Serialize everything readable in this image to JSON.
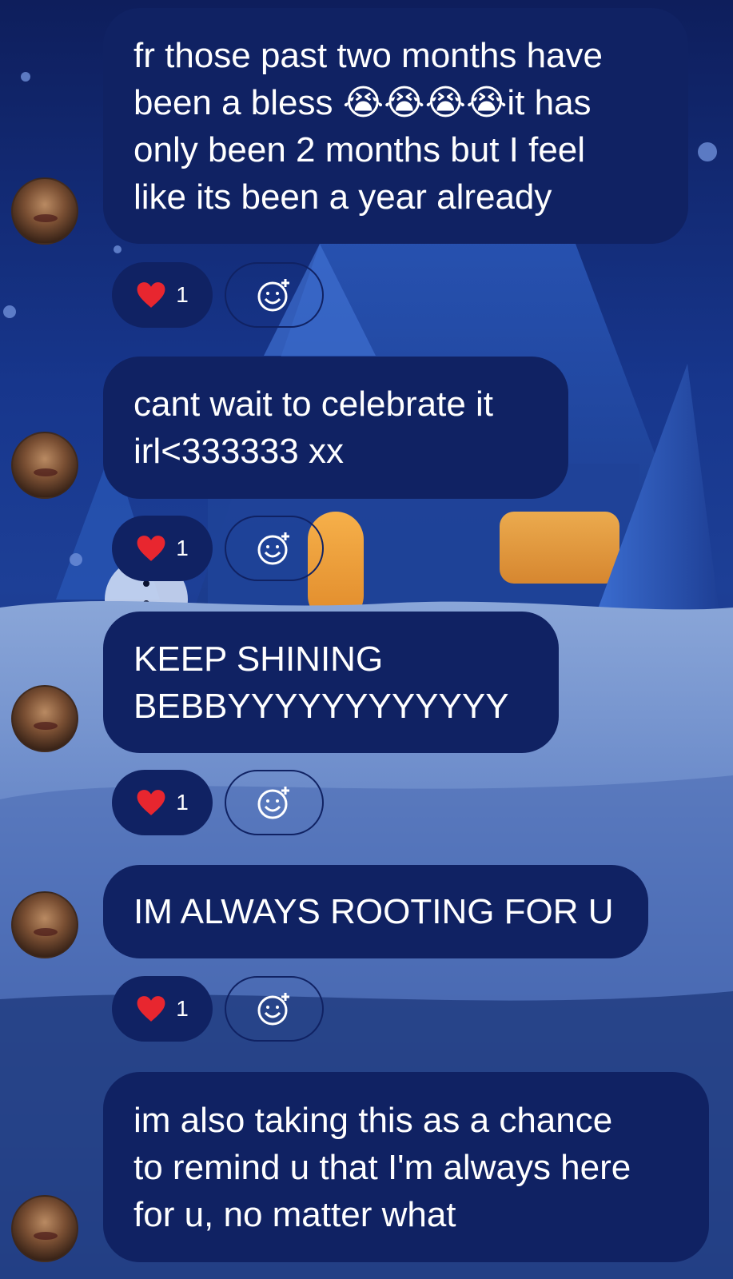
{
  "messages": [
    {
      "lines": [
        "fr those past two months have",
        "been a bless 😭😭😭😭it has",
        "only been 2 months but I feel",
        "like its  been a year already"
      ],
      "reaction": {
        "emoji": "❤️",
        "count": "1"
      }
    },
    {
      "lines": [
        "cant wait to celebrate it",
        "irl<333333 xx"
      ],
      "reaction": {
        "emoji": "❤️",
        "count": "1"
      }
    },
    {
      "lines": [
        "KEEP SHINING",
        "BEBBYYYYYYYYYYYY"
      ],
      "reaction": {
        "emoji": "❤️",
        "count": "1"
      }
    },
    {
      "lines": [
        "IM ALWAYS ROOTING FOR U"
      ],
      "reaction": {
        "emoji": "❤️",
        "count": "1"
      }
    },
    {
      "lines": [
        "im also taking this as a chance",
        "to remind u that I'm always here",
        "for u, no matter what"
      ]
    }
  ],
  "icons": {
    "heart": "heart-icon",
    "add_reaction": "add-reaction-smiley-icon"
  },
  "colors": {
    "bubble": "#102263",
    "heart": "#e8262f",
    "text": "#ffffff"
  }
}
